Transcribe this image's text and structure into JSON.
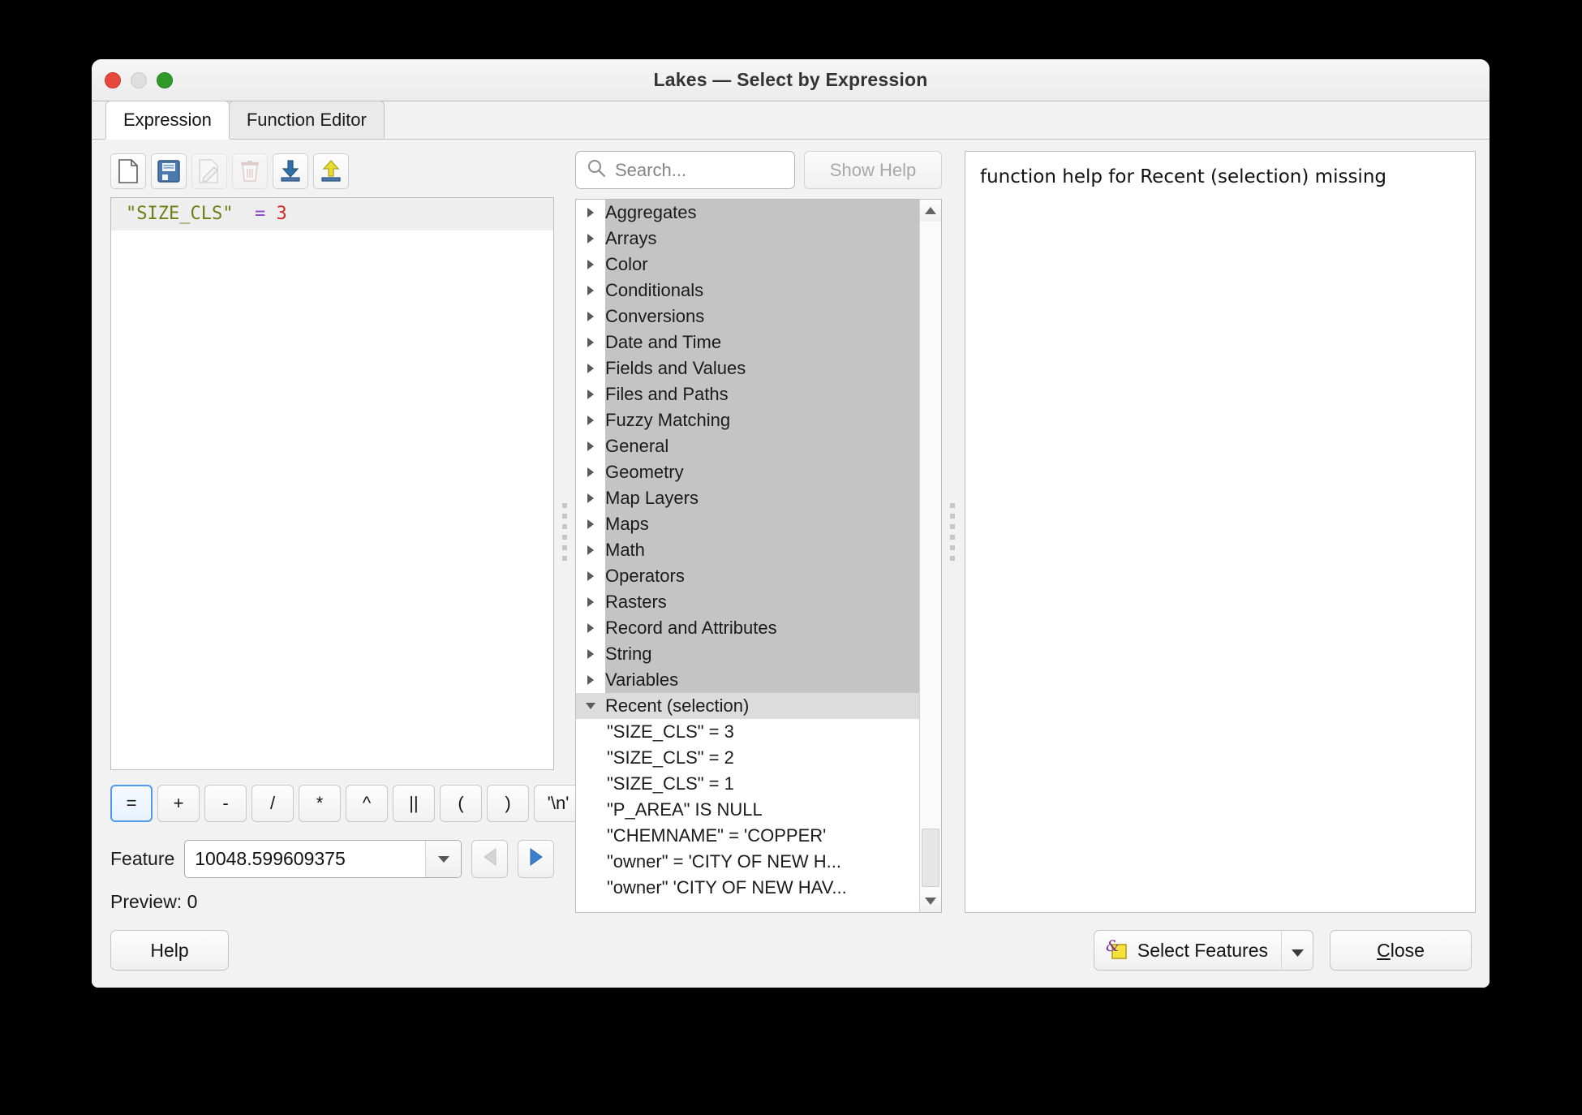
{
  "window": {
    "title": "Lakes — Select by Expression",
    "traffic_lights": [
      "close-red",
      "minimize-yellow",
      "zoom-green"
    ]
  },
  "tabs": [
    {
      "label": "Expression",
      "active": true
    },
    {
      "label": "Function Editor",
      "active": false
    }
  ],
  "expression_toolbar": [
    {
      "name": "new-file-icon",
      "title": "New",
      "enabled": true
    },
    {
      "name": "save-icon",
      "title": "Save",
      "enabled": true
    },
    {
      "name": "edit-pencil-icon",
      "title": "Edit",
      "enabled": false
    },
    {
      "name": "trash-icon",
      "title": "Delete",
      "enabled": false
    },
    {
      "name": "import-icon",
      "title": "Import",
      "enabled": true
    },
    {
      "name": "export-icon",
      "title": "Export",
      "enabled": true
    }
  ],
  "expression_editor": {
    "field_token": "\"SIZE_CLS\"",
    "spacer": "  ",
    "operator_token": "=",
    "space2": " ",
    "number_token": "3",
    "full_text": "\"SIZE_CLS\"  = 3"
  },
  "operator_buttons": [
    {
      "label": "=",
      "focused": true
    },
    {
      "label": "+",
      "focused": false
    },
    {
      "label": "-",
      "focused": false
    },
    {
      "label": "/",
      "focused": false
    },
    {
      "label": "*",
      "focused": false
    },
    {
      "label": "^",
      "focused": false
    },
    {
      "label": "||",
      "focused": false
    },
    {
      "label": "(",
      "focused": false
    },
    {
      "label": ")",
      "focused": false
    },
    {
      "label": "'\\n'",
      "focused": false
    }
  ],
  "feature": {
    "label": "Feature",
    "value": "10048.599609375",
    "prev_enabled": false,
    "next_enabled": true
  },
  "preview": {
    "label": "Preview:",
    "value": "0"
  },
  "search": {
    "placeholder": "Search...",
    "value": ""
  },
  "show_help": {
    "label": "Show Help",
    "enabled": false
  },
  "function_tree": {
    "groups": [
      {
        "label": "Aggregates",
        "expanded": false
      },
      {
        "label": "Arrays",
        "expanded": false
      },
      {
        "label": "Color",
        "expanded": false
      },
      {
        "label": "Conditionals",
        "expanded": false
      },
      {
        "label": "Conversions",
        "expanded": false
      },
      {
        "label": "Date and Time",
        "expanded": false
      },
      {
        "label": "Fields and Values",
        "expanded": false
      },
      {
        "label": "Files and Paths",
        "expanded": false
      },
      {
        "label": "Fuzzy Matching",
        "expanded": false
      },
      {
        "label": "General",
        "expanded": false
      },
      {
        "label": "Geometry",
        "expanded": false
      },
      {
        "label": "Map Layers",
        "expanded": false
      },
      {
        "label": "Maps",
        "expanded": false
      },
      {
        "label": "Math",
        "expanded": false
      },
      {
        "label": "Operators",
        "expanded": false
      },
      {
        "label": "Rasters",
        "expanded": false
      },
      {
        "label": "Record and Attributes",
        "expanded": false
      },
      {
        "label": "String",
        "expanded": false
      },
      {
        "label": "Variables",
        "expanded": false
      }
    ],
    "recent": {
      "label": "Recent (selection)",
      "expanded": true,
      "selected": true,
      "items": [
        "\"SIZE_CLS\"  = 3",
        "\"SIZE_CLS\"  = 2",
        "\"SIZE_CLS\"  = 1",
        "\"P_AREA\" IS NULL",
        "\"CHEMNAME\"  =  'COPPER'",
        "\"owner\"  =  'CITY OF NEW H...",
        "\"owner\"  'CITY OF NEW HAV..."
      ]
    }
  },
  "help_panel": {
    "text": "function help for Recent (selection) missing"
  },
  "footer": {
    "help_label": "Help",
    "select_features_label": "Select Features",
    "close_label": "Close",
    "close_mnemonic": "C"
  },
  "colors": {
    "accent_blue": "#4f9bf0",
    "token_field": "#6f7d15",
    "token_operator": "#8e44c8",
    "token_number": "#d12a2a",
    "window_bg": "#f2f2f2",
    "tree_group_bg": "#c4c4c4",
    "tree_selected_bg": "#dcdcdc"
  }
}
